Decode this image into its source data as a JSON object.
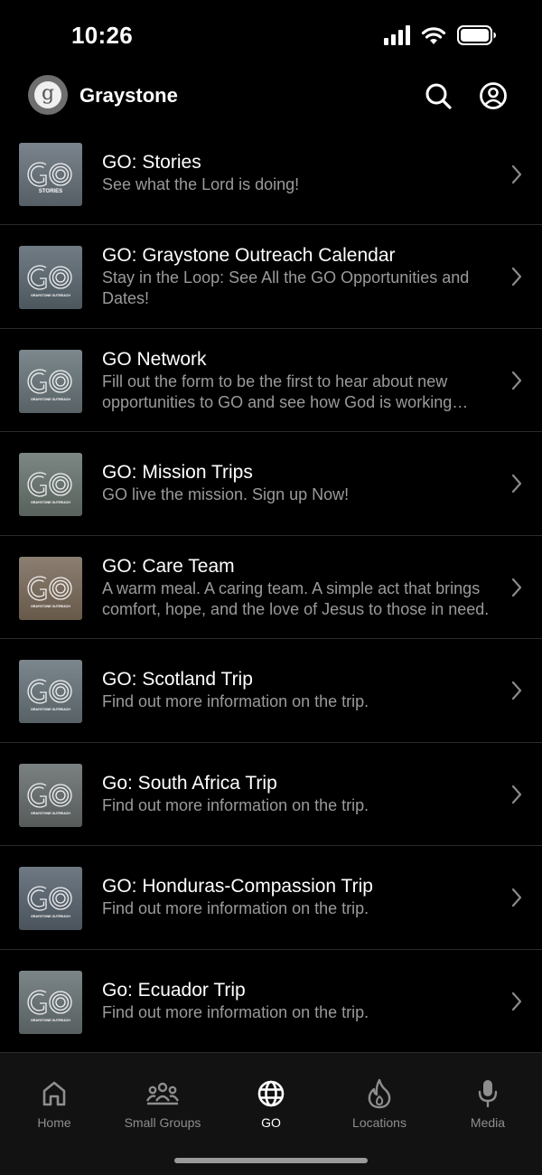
{
  "status": {
    "time": "10:26",
    "icons": [
      "cellular-signal-icon",
      "wifi-icon",
      "battery-icon"
    ]
  },
  "header": {
    "logo_letter": "g",
    "title": "Graystone",
    "icons": [
      "search-icon",
      "profile-icon"
    ]
  },
  "items": [
    {
      "title": "GO:  Stories",
      "subtitle": "See what the Lord is doing!",
      "thumb_text": "GO",
      "thumb_caption": "STORIES",
      "thumb_bg": "#6b757d"
    },
    {
      "title": "GO: Graystone Outreach Calendar",
      "subtitle": "Stay in the Loop: See All the GO Opportunities and Dates!",
      "thumb_text": "GO",
      "thumb_caption": "GRAYSTONE OUTREACH",
      "thumb_bg": "#5a6670"
    },
    {
      "title": "GO Network",
      "subtitle": "Fill out the form to be the first to hear about new opportunities to GO and see how God is working through Graystone!",
      "thumb_text": "GO",
      "thumb_caption": "GRAYSTONE OUTREACH",
      "thumb_bg": "#707b80"
    },
    {
      "title": "GO:  Mission Trips",
      "subtitle": "GO live the mission.  Sign up Now!",
      "thumb_text": "GO",
      "thumb_caption": "GRAYSTONE OUTREACH",
      "thumb_bg": "#6f7a6e"
    },
    {
      "title": "GO: Care Team",
      "subtitle": "A warm meal. A caring team. A simple act that brings comfort, hope, and the love of Jesus to those in need.",
      "thumb_text": "GO",
      "thumb_caption": "GRAYSTONE OUTREACH",
      "thumb_bg": "#8a6b4c"
    },
    {
      "title": "GO:  Scotland Trip",
      "subtitle": "Find out more information on the trip.",
      "thumb_text": "GO",
      "thumb_caption": "GRAYSTONE OUTREACH",
      "thumb_bg": "#6e7a80"
    },
    {
      "title": "Go:  South Africa Trip",
      "subtitle": "Find out more information on the trip.",
      "thumb_text": "GO",
      "thumb_caption": "GRAYSTONE OUTREACH",
      "thumb_bg": "#6b6f6a"
    },
    {
      "title": "GO: Honduras-Compassion Trip",
      "subtitle": "Find out more information on the trip.",
      "thumb_text": "GO",
      "thumb_caption": "GRAYSTONE OUTREACH",
      "thumb_bg": "#55606d"
    },
    {
      "title": "Go: Ecuador Trip",
      "subtitle": "Find out more information on the trip.",
      "thumb_text": "GO",
      "thumb_caption": "GRAYSTONE OUTREACH",
      "thumb_bg": "#6d7774"
    }
  ],
  "tabs": [
    {
      "label": "Home",
      "icon": "home-icon",
      "active": false
    },
    {
      "label": "Small Groups",
      "icon": "group-icon",
      "active": false
    },
    {
      "label": "GO",
      "icon": "globe-icon",
      "active": true
    },
    {
      "label": "Locations",
      "icon": "flame-icon",
      "active": false
    },
    {
      "label": "Media",
      "icon": "microphone-icon",
      "active": false
    }
  ]
}
